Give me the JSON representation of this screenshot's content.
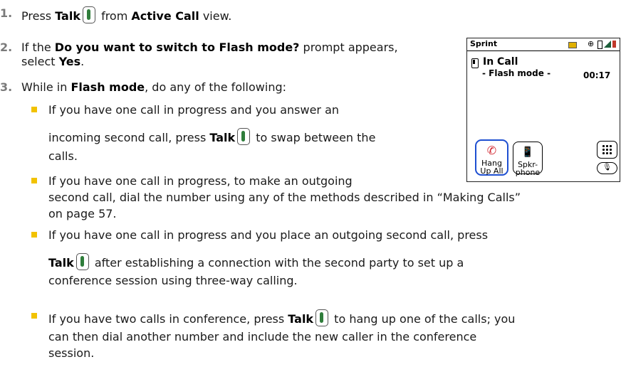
{
  "steps": [
    {
      "num": "1.",
      "pre": "Press ",
      "talk": "Talk",
      "mid": " from ",
      "b2": "Active Call",
      "post": " view."
    },
    {
      "num": "2.",
      "pre": "If the ",
      "b1": "Do you want to switch to Flash mode?",
      "post": " prompt appears,",
      "cont_pre": "select ",
      "cont_b": "Yes",
      "cont_post": "."
    },
    {
      "num": "3.",
      "pre": "While in ",
      "b1": "Flash mode",
      "post": ", do any of the following:"
    }
  ],
  "bullets": [
    {
      "l1": "If you have one call in progress and you answer an",
      "l2_pre": "incoming second call, press ",
      "l2_b": "Talk",
      "l2_post": " to swap between the",
      "l3": "calls."
    },
    {
      "l1": "If you have one call in progress, to make an outgoing",
      "l2": "second call, dial the number using any of the methods described in “Making Calls”",
      "l3": "on page 57."
    },
    {
      "l1": "If you have one call in progress and you place an outgoing second call, press",
      "l2_b": "Talk",
      "l2_post": " after establishing a connection with the second party to set up a",
      "l3": "conference session using three-way calling."
    },
    {
      "l1_pre": "If you have two calls in conference, press ",
      "l1_b": "Talk",
      "l1_post": " to hang up one of the calls; you",
      "l2": "can then dial another number and include the new caller in the conference",
      "l3": "session."
    }
  ],
  "phone": {
    "carrier": "Sprint",
    "title": "In Call",
    "mode": "- Flash mode -",
    "timer": "00:17",
    "hang_label_1": "Hang",
    "hang_label_2": "Up All",
    "spkr_label_1": "Spkr-",
    "spkr_label_2": "phone"
  },
  "icons": {
    "talk_key": "talk-key-icon",
    "hang_up": "phone-handset-icon",
    "speaker": "speakerphone-icon",
    "keypad": "keypad-icon",
    "mic": "microphone-icon"
  },
  "colors": {
    "bullet": "#f2c200",
    "step_number": "#7a7a7a",
    "talk_key_green": "#2f7d3b",
    "hang_up_red": "#d0202a",
    "hang_up_border": "#1e4fd1"
  }
}
